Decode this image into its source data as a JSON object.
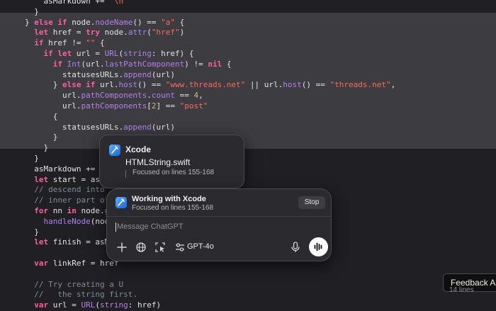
{
  "code_lines": [
    [
      [
        "    asMarkdown += ",
        "pl"
      ],
      [
        "\"\\n\"",
        "str"
      ]
    ],
    [
      [
        "  }",
        "pl"
      ]
    ],
    [
      [
        "} ",
        "pl"
      ],
      [
        "else if ",
        "kw"
      ],
      [
        "node.",
        "pl"
      ],
      [
        "nodeName",
        "prop"
      ],
      [
        "() == ",
        "pl"
      ],
      [
        "\"a\"",
        "str"
      ],
      [
        " {",
        "pl"
      ]
    ],
    [
      [
        "  ",
        "pl"
      ],
      [
        "let ",
        "kw"
      ],
      [
        "href = ",
        "pl"
      ],
      [
        "try ",
        "kw"
      ],
      [
        "node.",
        "pl"
      ],
      [
        "attr",
        "prop"
      ],
      [
        "(",
        "pl"
      ],
      [
        "\"href\"",
        "str"
      ],
      [
        ")",
        "pl"
      ]
    ],
    [
      [
        "  ",
        "pl"
      ],
      [
        "if ",
        "kw"
      ],
      [
        "href != ",
        "pl"
      ],
      [
        "\"\"",
        "str"
      ],
      [
        " {",
        "pl"
      ]
    ],
    [
      [
        "    ",
        "pl"
      ],
      [
        "if let ",
        "kw"
      ],
      [
        "url = ",
        "pl"
      ],
      [
        "URL",
        "prop"
      ],
      [
        "(",
        "pl"
      ],
      [
        "string",
        "prop"
      ],
      [
        ": href) {",
        "pl"
      ]
    ],
    [
      [
        "      ",
        "pl"
      ],
      [
        "if ",
        "kw"
      ],
      [
        "Int",
        "prop"
      ],
      [
        "(url.",
        "pl"
      ],
      [
        "lastPathComponent",
        "prop"
      ],
      [
        ") != ",
        "pl"
      ],
      [
        "nil",
        "kw"
      ],
      [
        " {",
        "pl"
      ]
    ],
    [
      [
        "        statusesURLs.",
        "pl"
      ],
      [
        "append",
        "prop"
      ],
      [
        "(url)",
        "pl"
      ]
    ],
    [
      [
        "      } ",
        "pl"
      ],
      [
        "else if ",
        "kw"
      ],
      [
        "url.",
        "pl"
      ],
      [
        "host",
        "prop"
      ],
      [
        "() == ",
        "pl"
      ],
      [
        "\"www.threads.net\"",
        "str"
      ],
      [
        " || url.",
        "pl"
      ],
      [
        "host",
        "prop"
      ],
      [
        "() == ",
        "pl"
      ],
      [
        "\"threads.net\"",
        "str"
      ],
      [
        ",",
        "pl"
      ]
    ],
    [
      [
        "        url.",
        "pl"
      ],
      [
        "pathComponents",
        "prop"
      ],
      [
        ".",
        "pl"
      ],
      [
        "count",
        "prop"
      ],
      [
        " == ",
        "pl"
      ],
      [
        "4",
        "num"
      ],
      [
        ",",
        "pl"
      ]
    ],
    [
      [
        "        url.",
        "pl"
      ],
      [
        "pathComponents",
        "prop"
      ],
      [
        "[",
        "pl"
      ],
      [
        "2",
        "num"
      ],
      [
        "] == ",
        "pl"
      ],
      [
        "\"post\"",
        "str"
      ]
    ],
    [
      [
        "      {",
        "pl"
      ]
    ],
    [
      [
        "        statusesURLs.",
        "pl"
      ],
      [
        "append",
        "prop"
      ],
      [
        "(url)",
        "pl"
      ]
    ],
    [
      [
        "      }",
        "pl"
      ]
    ],
    [
      [
        "    }",
        "pl"
      ]
    ],
    [
      [
        "  }",
        "pl"
      ]
    ],
    [
      [
        "  asMarkdown += ",
        "pl"
      ],
      [
        "\"[",
        "str"
      ]
    ],
    [
      [
        "  ",
        "pl"
      ],
      [
        "let ",
        "kw"
      ],
      [
        "start = asMa",
        "pl"
      ]
    ],
    [
      [
        "  // descend into",
        "cm"
      ]
    ],
    [
      [
        "  // inner part of",
        "cm"
      ]
    ],
    [
      [
        "  ",
        "pl"
      ],
      [
        "for ",
        "kw"
      ],
      [
        "nn ",
        "pl"
      ],
      [
        "in ",
        "kw"
      ],
      [
        "node.",
        "pl"
      ],
      [
        "getCh",
        "prop"
      ]
    ],
    [
      [
        "    ",
        "pl"
      ],
      [
        "handleNode",
        "prop"
      ],
      [
        "(node:",
        "pl"
      ]
    ],
    [
      [
        "  }",
        "pl"
      ]
    ],
    [
      [
        "  ",
        "pl"
      ],
      [
        "let ",
        "kw"
      ],
      [
        "finish = asMar",
        "pl"
      ]
    ],
    [
      [
        "",
        "pl"
      ]
    ],
    [
      [
        "  ",
        "pl"
      ],
      [
        "var ",
        "kw"
      ],
      [
        "linkRef = href",
        "pl"
      ]
    ],
    [
      [
        "",
        "pl"
      ]
    ],
    [
      [
        "  // Try creating a U",
        "cm"
      ]
    ],
    [
      [
        "  //   the string first.",
        "cm"
      ]
    ],
    [
      [
        "  ",
        "pl"
      ],
      [
        "var ",
        "kw"
      ],
      [
        "url = ",
        "pl"
      ],
      [
        "URL",
        "prop"
      ],
      [
        "(",
        "pl"
      ],
      [
        "string",
        "prop"
      ],
      [
        ": href)",
        "pl"
      ]
    ]
  ],
  "context_popover": {
    "app_name": "Xcode",
    "file_name": "HTMLString.swift",
    "focus": "Focused on lines 155-168"
  },
  "chat": {
    "title": "Working with Xcode",
    "subtitle": "Focused on lines 155-168",
    "stop_label": "Stop",
    "placeholder": "Message ChatGPT",
    "model": "GPT-4o"
  },
  "feedback": {
    "label": "Feedback As",
    "line_count": "14 lines"
  }
}
